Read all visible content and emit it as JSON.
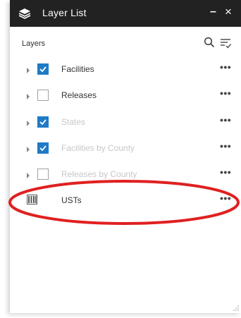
{
  "window": {
    "title": "Layer List",
    "minimize_glyph": "–",
    "close_glyph": "×"
  },
  "header": {
    "heading": "Layers"
  },
  "layers": [
    {
      "name": "Facilities",
      "checked": true,
      "muted": false,
      "icon": "expand-arrow"
    },
    {
      "name": "Releases",
      "checked": false,
      "muted": false,
      "icon": "expand-arrow"
    },
    {
      "name": "States",
      "checked": true,
      "muted": true,
      "icon": "expand-arrow"
    },
    {
      "name": "Facilities by County",
      "checked": true,
      "muted": true,
      "icon": "expand-arrow"
    },
    {
      "name": "Releases by County",
      "checked": false,
      "muted": true,
      "icon": "expand-arrow"
    },
    {
      "name": "USTs",
      "checked": null,
      "muted": false,
      "icon": "table-icon"
    }
  ],
  "more_glyph": "•••",
  "colors": {
    "title_bar": "#222222",
    "checkbox_checked": "#1e7bc6",
    "annotation": "#e02020",
    "muted_text": "#c7c7c7"
  }
}
